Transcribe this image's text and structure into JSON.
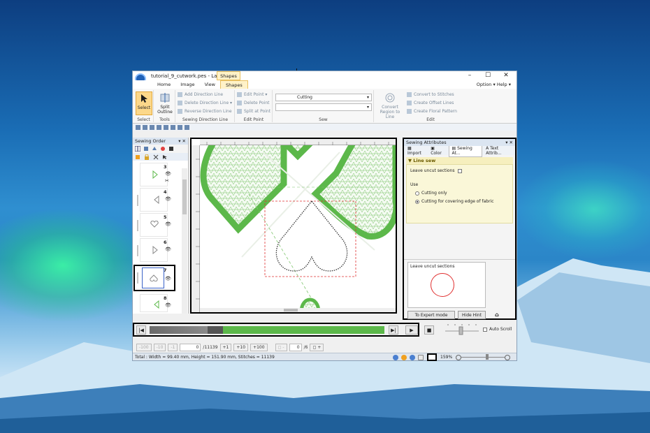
{
  "window": {
    "title": "tutorial_9_cutwork.pes - Layo...",
    "context_tab": "Shapes",
    "controls": {
      "minimize": "–",
      "maximize": "☐",
      "close": "✕"
    }
  },
  "menu_tabs": [
    "Home",
    "Image",
    "View",
    "Shapes"
  ],
  "menu_right": {
    "option": "Option",
    "help": "Help"
  },
  "ribbon": {
    "select": {
      "label": "Select",
      "group": "Select"
    },
    "tools": {
      "label": "Split Outline",
      "group": "Tools"
    },
    "sewing_direction": {
      "items": [
        "Add Direction Line",
        "Delete Direction Line",
        "Reverse Direction Line"
      ],
      "group": "Sewing Direction Line"
    },
    "edit_point": {
      "items": [
        "Edit Point",
        "Delete Point",
        "Split at Point"
      ],
      "group": "Edit Point"
    },
    "sew": {
      "combo1_value": "Cutting",
      "group": "Sew"
    },
    "edit": {
      "convert_label": "Convert Region to Line",
      "items": [
        "Convert to Stitches",
        "Create Offset Lines",
        "Create Floral Pattern"
      ],
      "group": "Edit"
    }
  },
  "sewing_order": {
    "title": "Sewing Order",
    "items": [
      {
        "num": "3"
      },
      {
        "num": "4"
      },
      {
        "num": "5"
      },
      {
        "num": "6"
      },
      {
        "num": "7"
      },
      {
        "num": "8"
      }
    ]
  },
  "attributes": {
    "title": "Sewing Attributes",
    "tabs": [
      "Import",
      "Color",
      "Sewing At...",
      "Text Attrib..."
    ],
    "section": "Line sew",
    "leave_uncut": "Leave uncut sections",
    "use_label": "Use",
    "options": [
      "Cutting only",
      "Cutting for covering edge of fabric"
    ],
    "hint_title": "Leave uncut sections",
    "expert_btn": "To Expert mode",
    "hide_hint_btn": "Hide Hint"
  },
  "simulator": {
    "auto_scroll": "Auto Scroll"
  },
  "stepbar": {
    "btns": [
      "-100",
      "-10",
      "-1",
      "+1",
      "+10",
      "+100"
    ],
    "stitch_value": "0",
    "stitch_total": "/11139",
    "color_value": "0",
    "color_total": "/6"
  },
  "status": {
    "text": "Total : Width = 99.40 mm, Height = 151.90 mm, Stitches = 11139",
    "zoom": "159%"
  },
  "colors": {
    "accent": "#fcd88a",
    "embroidery": "#5cb84a",
    "cut_line": "#e03030"
  }
}
